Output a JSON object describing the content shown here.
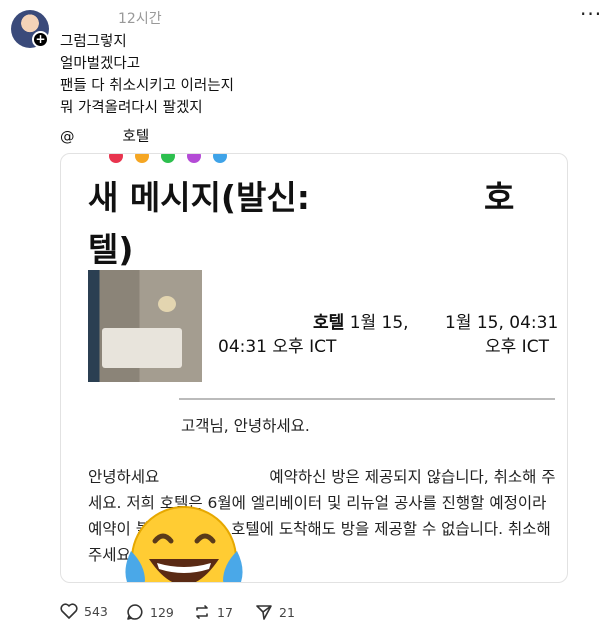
{
  "post": {
    "time": "12시간",
    "more_label": "···",
    "text_lines": [
      "그럼그렇지",
      "얼마벌겠다고",
      "팬들 다 취소시키고 이러는지",
      "뭐 가격올려다시 팔겠지"
    ],
    "mention_prefix": "@",
    "mention_hotel": "호텔"
  },
  "message_card": {
    "title_left": "새 메시지(발신:",
    "title_right": "호",
    "title_line2": "텔)",
    "sender_name": "호텔",
    "sender_date_left": "1월 15,",
    "date_right_1": "1월 15, 04:31",
    "time_left": "04:31 오후 ICT",
    "time_right": "오후 ICT",
    "greeting": "고객님, 안녕하세요.",
    "body_start": "안녕하세요",
    "body_rest": "예약하신 방은 제공되지 않습니다, 취소해 주세요. 저희 호텔은 6월에 엘리베이터 및 리뉴얼 공사를 진행할 예정이라 예약이 불가능합니다. 호텔에 도착해도 방을 제공할 수 없습니다. 취소해주세요."
  },
  "actions": {
    "likes": "543",
    "comments": "129",
    "reposts": "17",
    "shares": "21"
  },
  "colors": {
    "dot_colors": [
      "#e8344e",
      "#f5a623",
      "#2dbf4e",
      "#b44bd6",
      "#3fa3e8"
    ],
    "meta_gray": "#999999"
  }
}
